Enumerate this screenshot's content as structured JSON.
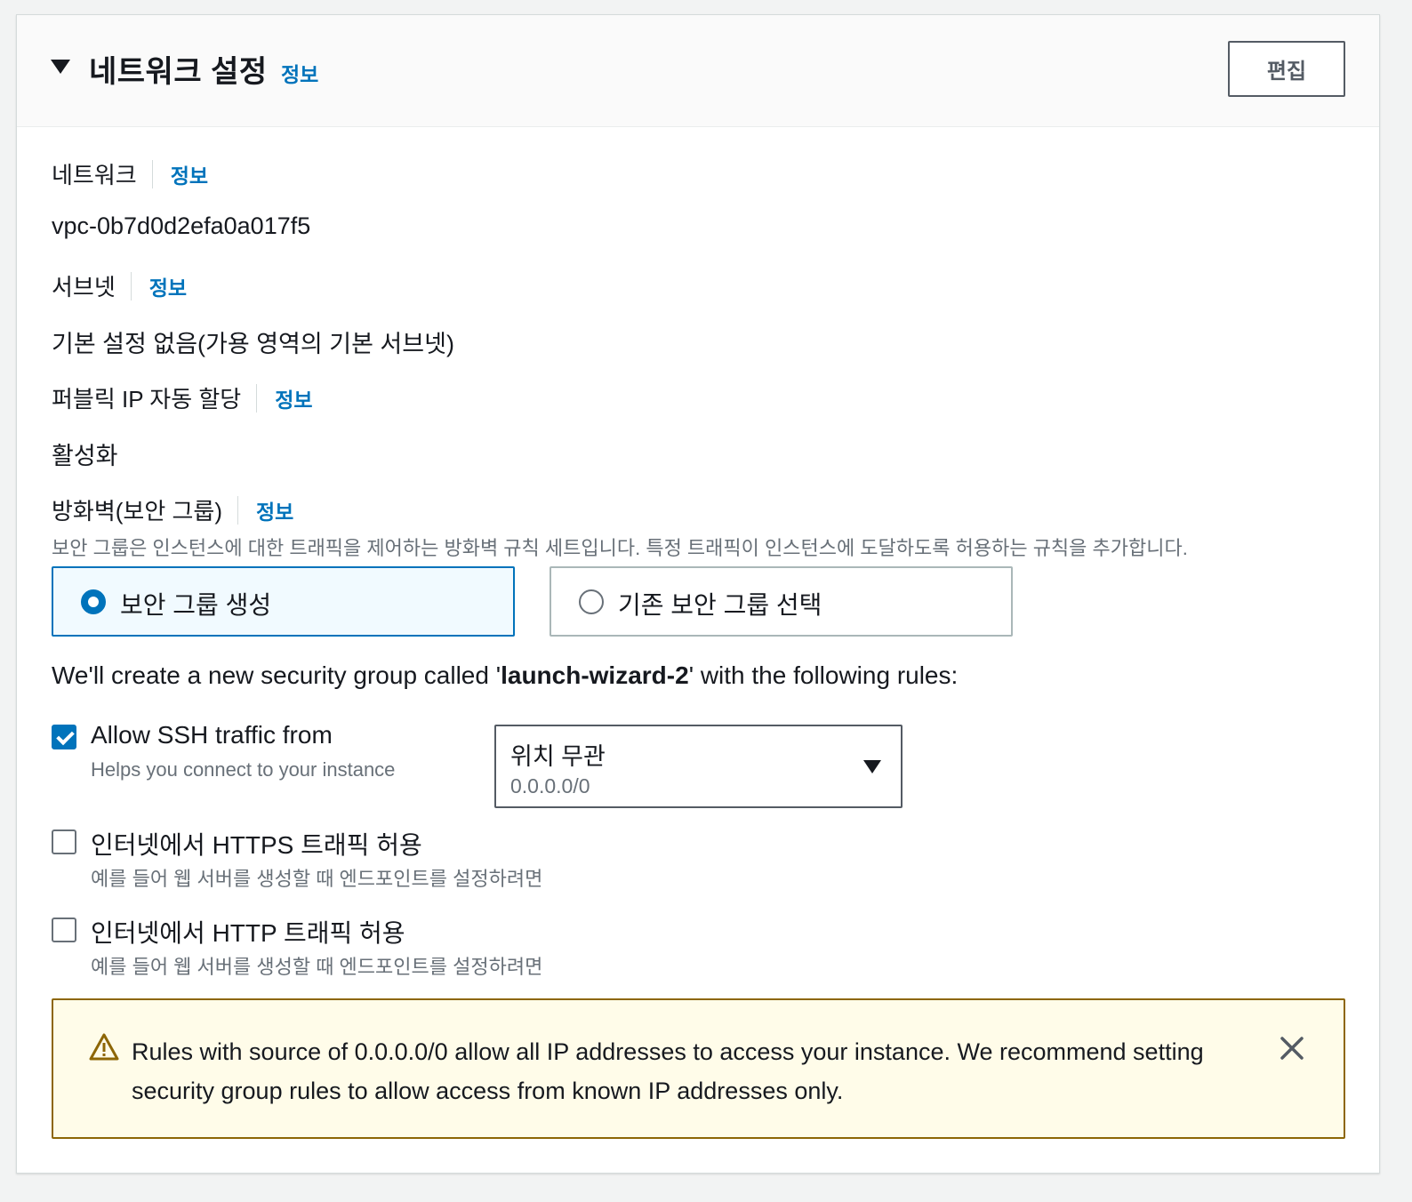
{
  "header": {
    "title": "네트워크 설정",
    "info": "정보",
    "edit_button": "편집"
  },
  "network": {
    "label": "네트워크",
    "info": "정보",
    "value": "vpc-0b7d0d2efa0a017f5"
  },
  "subnet": {
    "label": "서브넷",
    "info": "정보",
    "value": "기본 설정 없음(가용 영역의 기본 서브넷)"
  },
  "public_ip": {
    "label": "퍼블릭 IP 자동 할당",
    "info": "정보",
    "value": "활성화"
  },
  "firewall": {
    "label": "방화벽(보안 그룹)",
    "info": "정보",
    "description": "보안 그룹은 인스턴스에 대한 트래픽을 제어하는 방화벽 규칙 세트입니다. 특정 트래픽이 인스턴스에 도달하도록 허용하는 규칙을 추가합니다.",
    "options": [
      {
        "label": "보안 그룹 생성",
        "selected": true
      },
      {
        "label": "기존 보안 그룹 선택",
        "selected": false
      }
    ],
    "sentence_prefix": "We'll create a new security group called '",
    "group_name": "launch-wizard-2",
    "sentence_suffix": "' with the following rules:"
  },
  "rules": [
    {
      "label": "Allow SSH traffic from",
      "description": "Helps you connect to your instance",
      "checked": true
    },
    {
      "label": "인터넷에서 HTTPS 트래픽 허용",
      "description": "예를 들어 웹 서버를 생성할 때 엔드포인트를 설정하려면",
      "checked": false
    },
    {
      "label": "인터넷에서 HTTP 트래픽 허용",
      "description": "예를 들어 웹 서버를 생성할 때 엔드포인트를 설정하려면",
      "checked": false
    }
  ],
  "ssh_source_select": {
    "selected_label": "위치 무관",
    "selected_value": "0.0.0.0/0"
  },
  "warning": {
    "text": "Rules with source of 0.0.0.0/0 allow all IP addresses to access your instance. We recommend setting security group rules to allow access from known IP addresses only."
  },
  "colors": {
    "link": "#0073bb",
    "selected_tile_bg": "#f1faff",
    "warning_bg": "#fffce9",
    "warning_border": "#8d6605"
  }
}
